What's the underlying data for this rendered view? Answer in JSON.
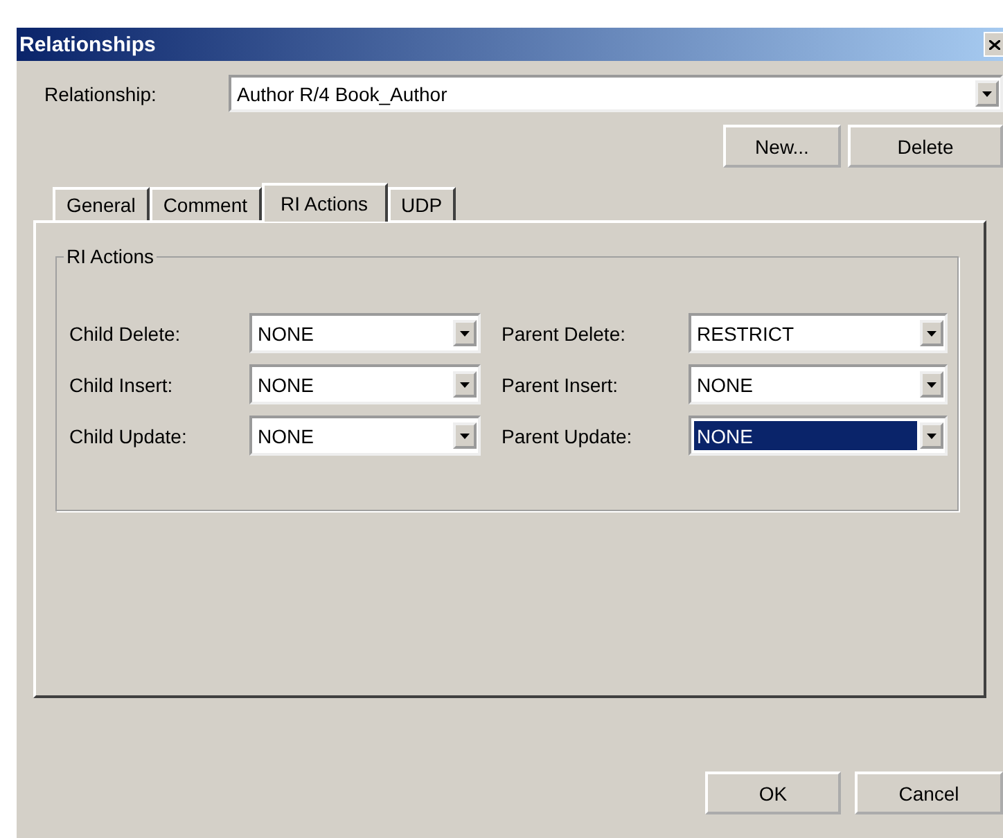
{
  "window": {
    "title": "Relationships"
  },
  "relationship": {
    "label": "Relationship:",
    "value": "Author R/4 Book_Author"
  },
  "top_buttons": [
    "New...",
    "Delete"
  ],
  "tabs": [
    {
      "label": "General",
      "selected": false
    },
    {
      "label": "Comment",
      "selected": false
    },
    {
      "label": "RI Actions",
      "selected": true
    },
    {
      "label": "UDP",
      "selected": false
    }
  ],
  "group": {
    "title": "RI Actions",
    "rows": [
      {
        "left": {
          "label": "Child Delete:",
          "value": "NONE",
          "selected": false
        },
        "right": {
          "label": "Parent Delete:",
          "value": "RESTRICT",
          "selected": false
        }
      },
      {
        "left": {
          "label": "Child Insert:",
          "value": "NONE",
          "selected": false
        },
        "right": {
          "label": "Parent Insert:",
          "value": "NONE",
          "selected": false
        }
      },
      {
        "left": {
          "label": "Child Update:",
          "value": "NONE",
          "selected": false
        },
        "right": {
          "label": "Parent Update:",
          "value": "NONE",
          "selected": true
        }
      }
    ]
  },
  "buttons": [
    "OK",
    "Cancel"
  ]
}
